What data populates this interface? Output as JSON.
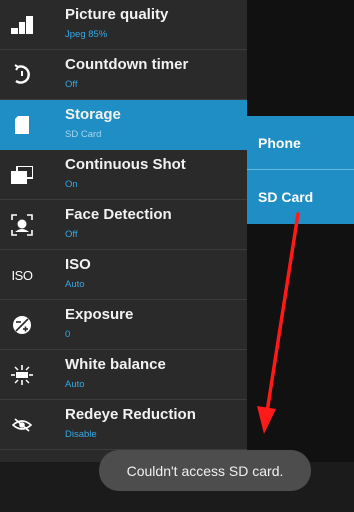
{
  "settings": {
    "items": [
      {
        "icon": "picture-quality-icon",
        "title": "Picture quality",
        "value": "Jpeg 85%"
      },
      {
        "icon": "countdown-timer-icon",
        "title": "Countdown timer",
        "value": "Off"
      },
      {
        "icon": "sd-card-icon",
        "title": "Storage",
        "value": "SD Card"
      },
      {
        "icon": "continuous-shot-icon",
        "title": "Continuous Shot",
        "value": "On"
      },
      {
        "icon": "face-detection-icon",
        "title": "Face Detection",
        "value": "Off"
      },
      {
        "icon": "iso-icon",
        "icon_text": "ISO",
        "title": "ISO",
        "value": "Auto"
      },
      {
        "icon": "exposure-icon",
        "title": "Exposure",
        "value": "0"
      },
      {
        "icon": "white-balance-icon",
        "title": "White balance",
        "value": "Auto"
      },
      {
        "icon": "redeye-reduction-icon",
        "title": "Redeye Reduction",
        "value": "Disable"
      }
    ],
    "selected_index": 2
  },
  "storage_submenu": {
    "options": [
      "Phone",
      "SD Card"
    ]
  },
  "toast": {
    "message": "Couldn't access SD card."
  },
  "colors": {
    "accent": "#1f8ec4",
    "value_text": "#34a9e6",
    "panel_bg": "#2a2a2a",
    "annotation_arrow": "#ff1a1a"
  }
}
